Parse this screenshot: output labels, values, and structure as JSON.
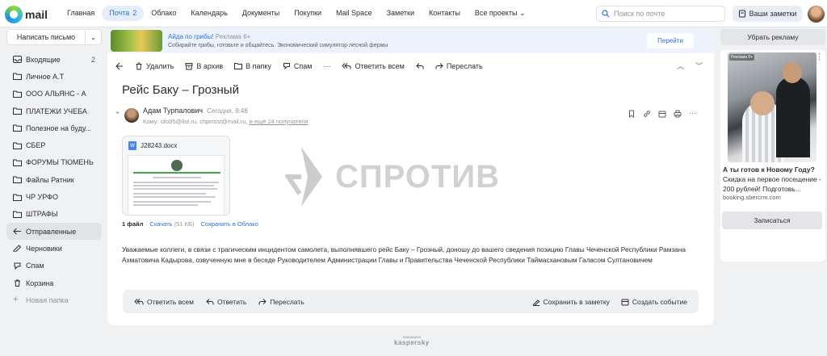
{
  "app": {
    "logo_text": "mail"
  },
  "nav": [
    {
      "label": "Главная",
      "active": false
    },
    {
      "label": "Почта",
      "active": true,
      "badge": "2"
    },
    {
      "label": "Облако",
      "active": false
    },
    {
      "label": "Календарь",
      "active": false
    },
    {
      "label": "Документы",
      "active": false
    },
    {
      "label": "Покупки",
      "active": false
    },
    {
      "label": "Mail Space",
      "active": false
    },
    {
      "label": "Заметки",
      "active": false
    },
    {
      "label": "Контакты",
      "active": false
    },
    {
      "label": "Все проекты",
      "active": false,
      "dropdown": true
    }
  ],
  "search": {
    "placeholder": "Поиск по почте"
  },
  "notes_button": "Ваши заметки",
  "sidebar": {
    "compose_label": "Написать письмо",
    "folders": [
      {
        "label": "Входящие",
        "icon": "inbox-icon",
        "count": "2"
      },
      {
        "label": "Личное А.Т",
        "icon": "folder-icon"
      },
      {
        "label": "ООО АЛЬЯНС - А",
        "icon": "folder-icon"
      },
      {
        "label": "ПЛАТЕЖИ УЧЕБА",
        "icon": "folder-icon"
      },
      {
        "label": "Полезное на буду...",
        "icon": "folder-icon"
      },
      {
        "label": "СБЕР",
        "icon": "folder-icon"
      },
      {
        "label": "ФОРУМЫ ТЮМЕНЬ",
        "icon": "folder-icon"
      },
      {
        "label": "Файлы Ратник",
        "icon": "folder-icon"
      },
      {
        "label": "ЧР УРФО",
        "icon": "folder-icon"
      },
      {
        "label": "ШТРАФЫ",
        "icon": "folder-icon"
      },
      {
        "label": "Отправленные",
        "icon": "sent-icon",
        "active": true
      },
      {
        "label": "Черновики",
        "icon": "draft-icon"
      },
      {
        "label": "Спам",
        "icon": "spam-icon"
      },
      {
        "label": "Корзина",
        "icon": "trash-icon"
      }
    ],
    "new_folder": "Новая папка"
  },
  "ad_banner": {
    "title": "Айда по грибы!",
    "tag": "Реклама 6+",
    "subtitle": "Собирайте грибы, готовьте и общайтесь. Экономический симулятор лесной фермы",
    "button": "Перейти"
  },
  "toolbar": {
    "delete": "Удалить",
    "archive": "В архив",
    "to_folder": "В папку",
    "spam": "Спам",
    "reply_all": "Ответить всем",
    "forward": "Переслать"
  },
  "message": {
    "subject": "Рейс Баку – Грозный",
    "sender": "Адам Турпалович",
    "time": "Сегодня, 9:48",
    "to_label": "Кому:",
    "to_1": "ufo95@list.ru,",
    "to_2": "chprrost@mail.ru,",
    "to_more": "и ещё 24 получателя",
    "attachment": {
      "name": "J28243.docx",
      "count_label": "1 файл",
      "download": "Скачать",
      "size": "(51 КБ)",
      "save_cloud": "Сохранить в Облако"
    },
    "watermark": "СПРОТИВ",
    "body": "Уважаемые коллеги, в связи с трагическим инцидентом самолета, выполнявшего рейс Баку – Грозный, доношу до вашего сведения позицию Главы Чеченской Республики Рамзана Ахматовича Кадырова, озвученную мне в беседе Руководителем Администрации Главы и Правительства Чеченской Республики Таймасхановым Галасом Султановичем"
  },
  "reply_bar": {
    "reply_all": "Ответить всем",
    "reply": "Ответить",
    "forward": "Переслать",
    "save_note": "Сохранить в заметку",
    "create_event": "Создать событие"
  },
  "footer": {
    "small": "Защищено",
    "brand": "kaspersky"
  },
  "right_ad": {
    "remove": "Убрать рекламу",
    "tag": "Реклама 0+",
    "title": "А ты готов к Новому Году?",
    "desc": "Скидка на первое посещение - 200 рублей! Подготовь...",
    "url": "booking.sbercrm.com",
    "button": "Записаться"
  },
  "colors": {
    "accent": "#2d6fd6",
    "background": "#f0f1f3"
  }
}
